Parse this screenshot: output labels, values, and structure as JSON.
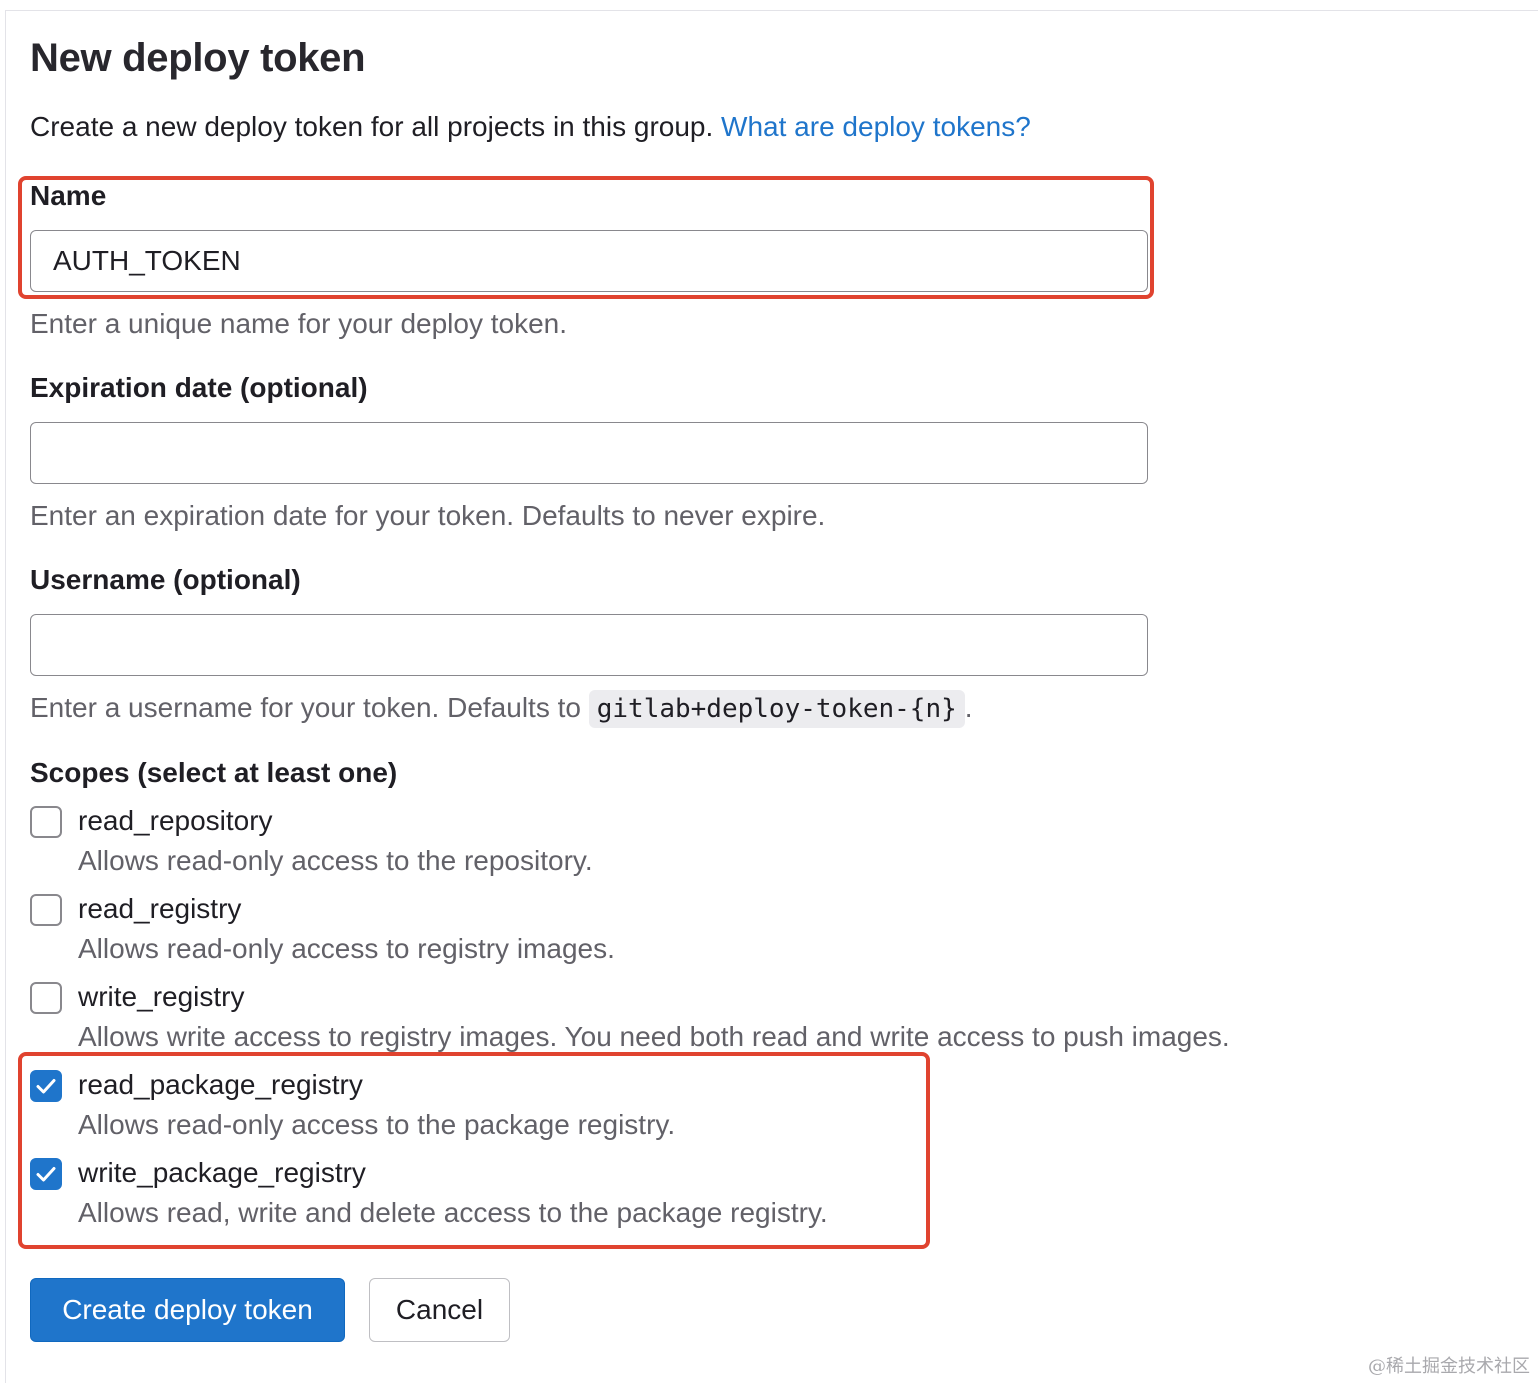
{
  "page": {
    "title": "New deploy token",
    "intro_text": "Create a new deploy token for all projects in this group.",
    "intro_link": "What are deploy tokens?"
  },
  "form": {
    "name": {
      "label": "Name",
      "value": "AUTH_TOKEN",
      "help": "Enter a unique name for your deploy token."
    },
    "expiration": {
      "label": "Expiration date (optional)",
      "value": "",
      "help": "Enter an expiration date for your token. Defaults to never expire."
    },
    "username": {
      "label": "Username (optional)",
      "value": "",
      "help_prefix": "Enter a username for your token. Defaults to",
      "help_code": "gitlab+deploy-token-{n}",
      "help_suffix": "."
    },
    "scopes": {
      "label": "Scopes (select at least one)",
      "items": [
        {
          "name": "read_repository",
          "description": "Allows read-only access to the repository.",
          "checked": false
        },
        {
          "name": "read_registry",
          "description": "Allows read-only access to registry images.",
          "checked": false
        },
        {
          "name": "write_registry",
          "description": "Allows write access to registry images. You need both read and write access to push images.",
          "checked": false
        },
        {
          "name": "read_package_registry",
          "description": "Allows read-only access to the package registry.",
          "checked": true
        },
        {
          "name": "write_package_registry",
          "description": "Allows read, write and delete access to the package registry.",
          "checked": true
        }
      ]
    }
  },
  "actions": {
    "submit_label": "Create deploy token",
    "cancel_label": "Cancel"
  },
  "watermark": "@稀土掘金技术社区",
  "colors": {
    "primary": "#1f75cb",
    "highlight": "#e0432f",
    "help_text": "#626168"
  },
  "icons": {
    "checkmark": "check-icon"
  }
}
